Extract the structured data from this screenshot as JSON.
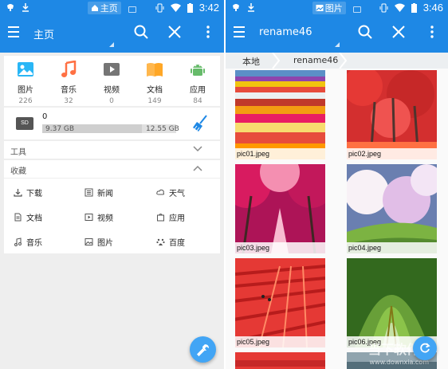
{
  "left": {
    "status": {
      "time": "3:42",
      "tab_label": "主页"
    },
    "appbar": {
      "title": "主页"
    },
    "categories": [
      {
        "label": "图片",
        "count": "226",
        "icon": "image-icon",
        "color": "#29b6f6"
      },
      {
        "label": "音乐",
        "count": "32",
        "icon": "music-icon",
        "color": "#ff7043"
      },
      {
        "label": "视频",
        "count": "0",
        "icon": "video-icon",
        "color": "#757575"
      },
      {
        "label": "文档",
        "count": "149",
        "icon": "document-icon",
        "color": "#ffb74d"
      },
      {
        "label": "应用",
        "count": "84",
        "icon": "android-icon",
        "color": "#66bb6a"
      }
    ],
    "storage": {
      "name": "0",
      "used": "9.37 GB",
      "total": "12.55 GB",
      "used_fraction": 0.746
    },
    "sections": {
      "tools": "工具",
      "favorites": "收藏"
    },
    "favorites": [
      {
        "label": "下载",
        "icon": "download-icon"
      },
      {
        "label": "新闻",
        "icon": "news-icon"
      },
      {
        "label": "天气",
        "icon": "weather-icon"
      },
      {
        "label": "文档",
        "icon": "document-icon"
      },
      {
        "label": "视频",
        "icon": "video-icon"
      },
      {
        "label": "应用",
        "icon": "app-icon"
      },
      {
        "label": "音乐",
        "icon": "music-icon"
      },
      {
        "label": "图片",
        "icon": "image-icon"
      },
      {
        "label": "百度",
        "icon": "baidu-icon"
      }
    ]
  },
  "right": {
    "status": {
      "time": "3:46",
      "tab_label": "图片"
    },
    "appbar": {
      "title": "rename46"
    },
    "breadcrumb": [
      "本地",
      "rename46"
    ],
    "images": [
      "pic01.jpeg",
      "pic02.jpeg",
      "pic03.jpeg",
      "pic04.jpeg",
      "pic05.jpeg",
      "pic06.jpeg"
    ]
  },
  "watermark": {
    "text": "当下软件园",
    "url": "www.downxia.com"
  },
  "colors": {
    "primary": "#1e88e5",
    "fab": "#42a5f5",
    "background": "#eeeeee"
  }
}
